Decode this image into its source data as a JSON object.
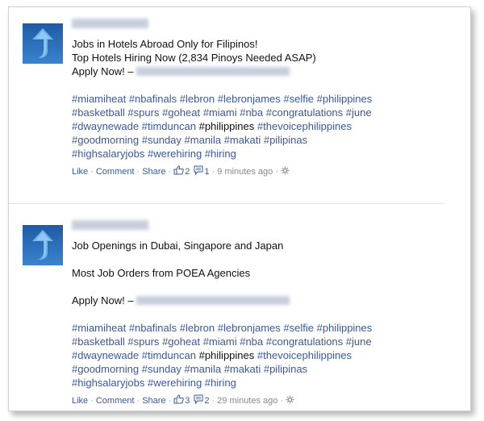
{
  "posts": [
    {
      "message_lines": [
        "Jobs in Hotels Abroad Only for Filipinos!",
        "Top Hotels Hiring Now (2,834 Pinoys Needed ASAP)"
      ],
      "apply_label": "Apply Now! –",
      "hashtag_lines": [
        [
          {
            "t": "#miamiheat",
            "h": true
          },
          {
            "t": "#nbafinals",
            "h": true
          },
          {
            "t": "#lebron",
            "h": true
          },
          {
            "t": "#lebronjames",
            "h": true
          },
          {
            "t": "#selfie",
            "h": true
          },
          {
            "t": "#philippines",
            "h": true
          }
        ],
        [
          {
            "t": "#basketball",
            "h": true
          },
          {
            "t": "#spurs",
            "h": true
          },
          {
            "t": "#goheat",
            "h": true
          },
          {
            "t": "#miami",
            "h": true
          },
          {
            "t": "#nba",
            "h": true
          },
          {
            "t": "#congratulations",
            "h": true
          },
          {
            "t": "#june",
            "h": true
          }
        ],
        [
          {
            "t": "#dwaynewade",
            "h": true
          },
          {
            "t": "#timduncan",
            "h": true
          },
          {
            "t": "#philippines",
            "h": false
          },
          {
            "t": "#thevoicephilippines",
            "h": true
          }
        ],
        [
          {
            "t": "#goodmorning",
            "h": true
          },
          {
            "t": "#sunday",
            "h": true
          },
          {
            "t": "#manila",
            "h": true
          },
          {
            "t": "#makati",
            "h": true
          },
          {
            "t": "#pilipinas",
            "h": true
          }
        ],
        [
          {
            "t": "#highsalaryjobs",
            "h": true
          },
          {
            "t": "#werehiring",
            "h": true
          },
          {
            "t": "#hiring",
            "h": true
          }
        ]
      ],
      "actions": {
        "like": "Like",
        "comment": "Comment",
        "share": "Share",
        "likes": "2",
        "comments": "1",
        "time": "9 minutes ago"
      }
    },
    {
      "message_lines": [
        "Job Openings in Dubai, Singapore and Japan",
        "",
        "Most Job Orders from POEA Agencies",
        ""
      ],
      "apply_label": "Apply Now! –",
      "hashtag_lines": [
        [
          {
            "t": "#miamiheat",
            "h": true
          },
          {
            "t": "#nbafinals",
            "h": true
          },
          {
            "t": "#lebron",
            "h": true
          },
          {
            "t": "#lebronjames",
            "h": true
          },
          {
            "t": "#selfie",
            "h": true
          },
          {
            "t": "#philippines",
            "h": true
          }
        ],
        [
          {
            "t": "#basketball",
            "h": true
          },
          {
            "t": "#spurs",
            "h": true
          },
          {
            "t": "#goheat",
            "h": true
          },
          {
            "t": "#miami",
            "h": true
          },
          {
            "t": "#nba",
            "h": true
          },
          {
            "t": "#congratulations",
            "h": true
          },
          {
            "t": "#june",
            "h": true
          }
        ],
        [
          {
            "t": "#dwaynewade",
            "h": true
          },
          {
            "t": "#timduncan",
            "h": true
          },
          {
            "t": "#philippines",
            "h": false
          },
          {
            "t": "#thevoicephilippines",
            "h": true
          }
        ],
        [
          {
            "t": "#goodmorning",
            "h": true
          },
          {
            "t": "#sunday",
            "h": true
          },
          {
            "t": "#manila",
            "h": true
          },
          {
            "t": "#makati",
            "h": true
          },
          {
            "t": "#pilipinas",
            "h": true
          }
        ],
        [
          {
            "t": "#highsalaryjobs",
            "h": true
          },
          {
            "t": "#werehiring",
            "h": true
          },
          {
            "t": "#hiring",
            "h": true
          }
        ]
      ],
      "actions": {
        "like": "Like",
        "comment": "Comment",
        "share": "Share",
        "likes": "3",
        "comments": "2",
        "time": "29 minutes ago"
      }
    }
  ],
  "colors": {
    "link": "#3b5998",
    "meta": "#888888",
    "avatar": "#2f6fbd"
  }
}
